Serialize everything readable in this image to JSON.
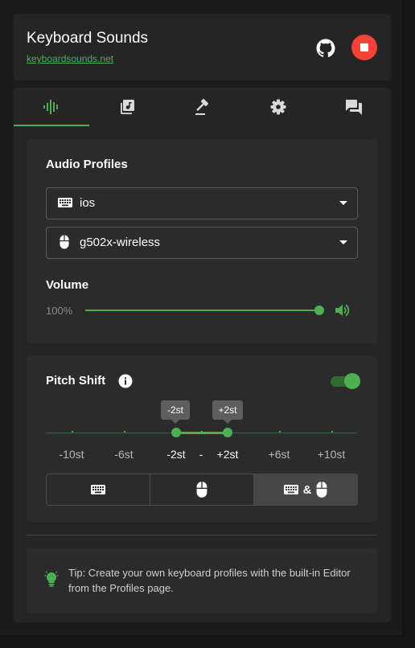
{
  "header": {
    "title": "Keyboard Sounds",
    "link_text": "keyboardsounds.net",
    "github_icon": "github-icon",
    "stop_icon": "stop-icon",
    "stop_color": "#f44336"
  },
  "tabs": [
    {
      "name": "audio",
      "icon": "waveform-icon",
      "selected": true
    },
    {
      "name": "library",
      "icon": "music-library-icon",
      "selected": false
    },
    {
      "name": "rules",
      "icon": "gavel-icon",
      "selected": false
    },
    {
      "name": "settings",
      "icon": "gear-icon",
      "selected": false
    },
    {
      "name": "feedback",
      "icon": "chat-icon",
      "selected": false
    }
  ],
  "audio_profiles": {
    "title": "Audio Profiles",
    "keyboard_profile": {
      "icon": "keyboard-icon",
      "value": "ios"
    },
    "mouse_profile": {
      "icon": "mouse-icon",
      "value": "g502x-wireless"
    }
  },
  "volume": {
    "title": "Volume",
    "label": "100%",
    "value_fraction": 1.0,
    "icon": "speaker-icon"
  },
  "pitch_shift": {
    "title": "Pitch Shift",
    "info_icon": "info-icon",
    "enabled": true,
    "range": [
      -2,
      2
    ],
    "low_label": "-2st",
    "high_label": "+2st",
    "marks": [
      "-10st",
      "-6st",
      "-2st",
      "-",
      "+2st",
      "+6st",
      "+10st"
    ],
    "scope_options": [
      {
        "icons": [
          "keyboard-icon"
        ],
        "text": "",
        "selected": false
      },
      {
        "icons": [
          "mouse-icon"
        ],
        "text": "",
        "selected": false
      },
      {
        "icons": [
          "keyboard-icon",
          "mouse-icon"
        ],
        "text": "&",
        "selected": true
      }
    ]
  },
  "tip": {
    "icon": "lightbulb-icon",
    "text": "Tip: Create your own keyboard profiles with the built-in Editor from the Profiles page."
  },
  "accent_color": "#4caf50"
}
